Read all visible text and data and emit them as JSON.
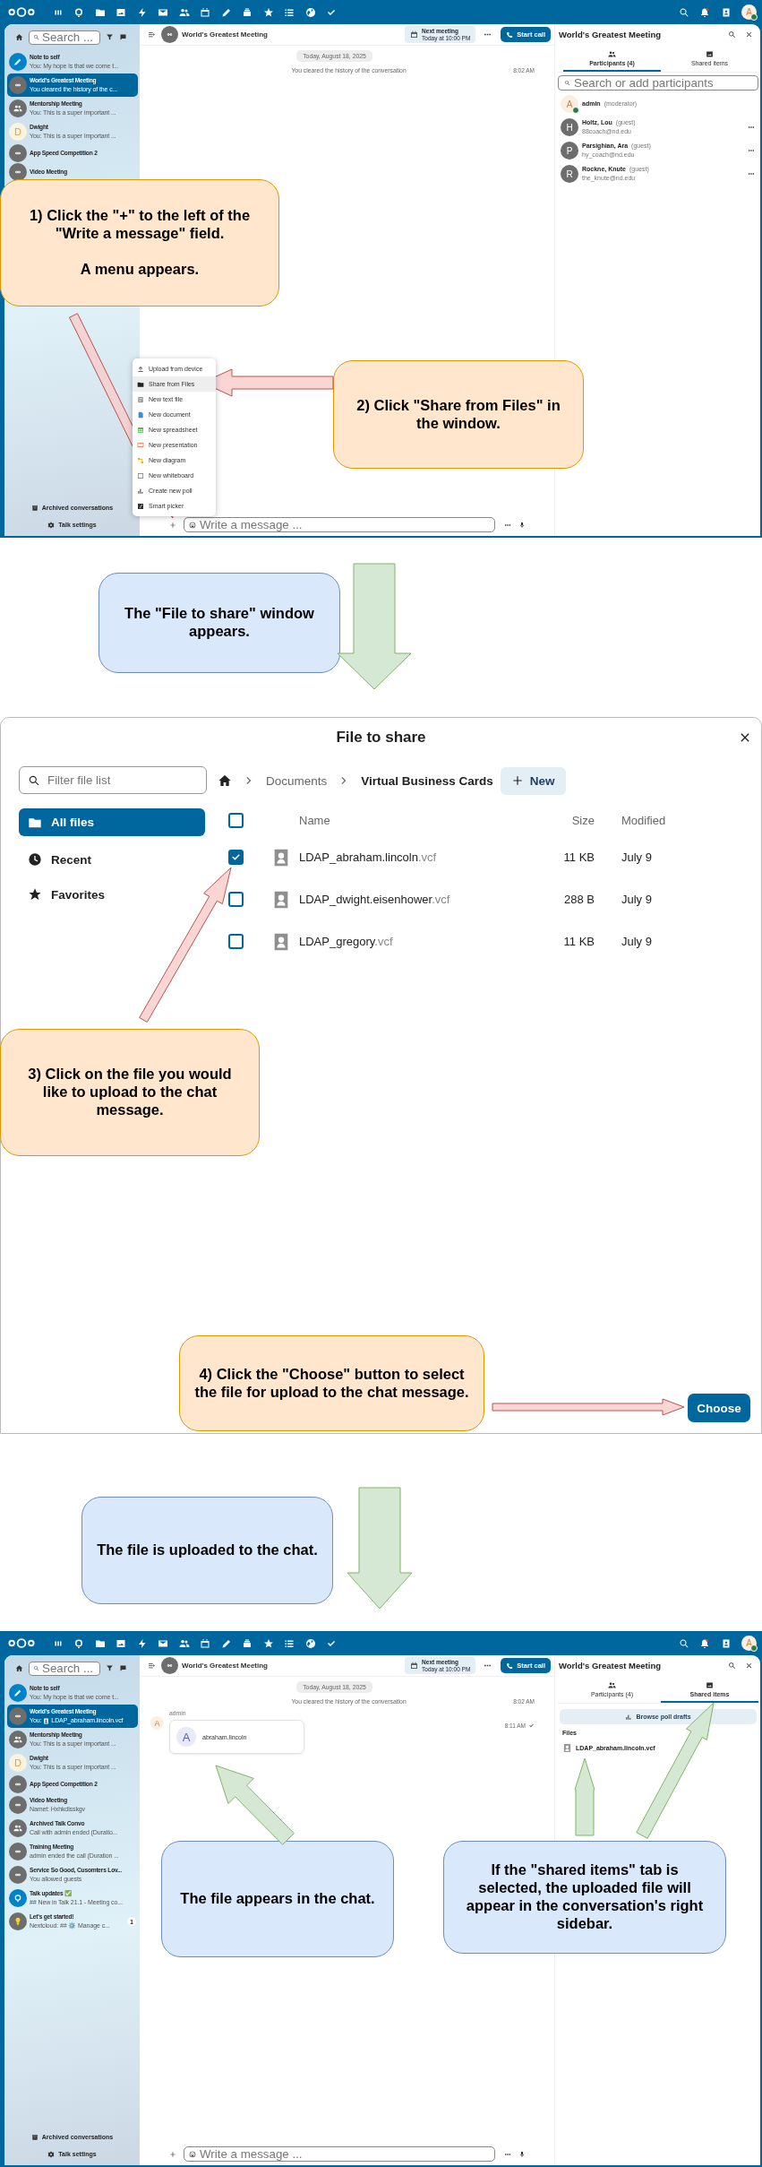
{
  "sections": [
    {
      "kind": "talk",
      "app_bar": {
        "avatar": "A",
        "online": true
      },
      "sidebar": {
        "search_placeholder": "Search ...",
        "conversations": [
          {
            "kind": "note",
            "name": "Note to self",
            "preview": "You: My hope is that we come t...",
            "selected": false
          },
          {
            "kind": "public",
            "name": "World's Greatest Meeting",
            "preview": "You cleared the history of the c...",
            "selected": true
          },
          {
            "kind": "group",
            "name": "Mentorship Meeting",
            "preview": "You: This is a super important ...",
            "selected": false
          },
          {
            "kind": "user",
            "initial": "D",
            "name": "Dwight",
            "preview": "You: This is a super important ...",
            "selected": false
          },
          {
            "kind": "public",
            "name": "App Speed Competition 2",
            "selected": false
          },
          {
            "kind": "public",
            "name": "Video Meeting",
            "selected": false
          }
        ],
        "footer": [
          "Archived conversations",
          "Talk settings"
        ]
      },
      "chat": {
        "title": "World's Greatest Meeting",
        "next_meeting": {
          "label": "Next meeting",
          "time": "Today at 10:00 PM"
        },
        "call_button": "Start call",
        "date": "Today, August 18, 2025",
        "events": [
          {
            "kind": "system",
            "text": "You cleared the history of the conversation",
            "time": "8:02 AM"
          }
        ],
        "composer_placeholder": "Write a message ..."
      },
      "menu": {
        "items": [
          {
            "label": "Upload from device",
            "selected": false
          },
          {
            "label": "Share from Files",
            "selected": true
          },
          {
            "label": "New text file",
            "selected": false
          },
          {
            "label": "New document",
            "selected": false
          },
          {
            "label": "New spreadsheet",
            "selected": false
          },
          {
            "label": "New presentation",
            "selected": false
          },
          {
            "label": "New diagram",
            "selected": false
          },
          {
            "label": "New whiteboard",
            "selected": false
          },
          {
            "label": "Create new poll",
            "selected": false
          },
          {
            "label": "Smart picker",
            "selected": false
          }
        ]
      },
      "details": {
        "title": "World's Greatest Meeting",
        "tabs": [
          {
            "label": "Participants (4)",
            "selected": true
          },
          {
            "label": "Shared items",
            "selected": false
          }
        ],
        "search_placeholder": "Search or add participants",
        "participants": [
          {
            "kind": "moderator",
            "initial": "A",
            "name": "admin",
            "role": "(moderator)",
            "online": true
          },
          {
            "kind": "guest",
            "initial": "H",
            "name": "Holtz, Lou",
            "role": "(guest)",
            "email": "88coach@nd.edu",
            "online": false
          },
          {
            "kind": "guest",
            "initial": "P",
            "name": "Parsighian, Ara",
            "role": "(guest)",
            "email": "hy_coach@nd.edu",
            "online": false
          },
          {
            "kind": "guest",
            "initial": "R",
            "name": "Rockne, Knute",
            "role": "(guest)",
            "email": "the_knute@nd.edu",
            "online": false
          }
        ]
      },
      "callouts": [
        {
          "kind": "step",
          "paragraphs": [
            "1) Click the \"+\" to the left of the \"Write a message\" field.",
            "A menu appears."
          ]
        },
        {
          "kind": "step",
          "paragraphs": [
            "2) Click \"Share from Files\" in the window."
          ]
        }
      ]
    },
    {
      "kind": "transition",
      "callout": {
        "kind": "note",
        "paragraphs": [
          "The \"File to share\" window appears."
        ]
      }
    },
    {
      "kind": "picker",
      "title": "File to share",
      "filter_placeholder": "Filter file list",
      "places": [
        {
          "label": "All files",
          "selected": true
        },
        {
          "label": "Recent",
          "selected": false
        },
        {
          "label": "Favorites",
          "selected": false
        }
      ],
      "breadcrumb": [
        "Documents",
        "Virtual Business Cards"
      ],
      "new_button": "New",
      "columns": [
        "Name",
        "Size",
        "Modified"
      ],
      "all_checked": false,
      "files": [
        {
          "name": "LDAP_abraham.lincoln",
          "extension": ".vcf",
          "size": "11 KB",
          "modified": "July 9",
          "checked": true
        },
        {
          "name": "LDAP_dwight.eisenhower",
          "extension": ".vcf",
          "size": "288 B",
          "modified": "July 9",
          "checked": false
        },
        {
          "name": "LDAP_gregory",
          "extension": ".vcf",
          "size": "11 KB",
          "modified": "July 9",
          "checked": false
        }
      ],
      "choose_button": "Choose",
      "callouts": [
        {
          "kind": "step",
          "paragraphs": [
            "3) Click on the file you would like to upload to the chat message."
          ]
        },
        {
          "kind": "step",
          "paragraphs": [
            "4) Click the \"Choose\" button to select the file for upload to the chat message."
          ]
        }
      ]
    },
    {
      "kind": "transition",
      "callout": {
        "kind": "note",
        "paragraphs": [
          "The file is uploaded to the chat."
        ]
      }
    },
    {
      "kind": "talk",
      "app_bar": {
        "avatar": "A",
        "online": true
      },
      "sidebar": {
        "search_placeholder": "Search ...",
        "conversations": [
          {
            "kind": "note",
            "name": "Note to self",
            "preview": "You: My hope is that we come t...",
            "selected": false
          },
          {
            "kind": "public",
            "name": "World's Greatest Meeting",
            "preview": "You:",
            "attachment": "LDAP_abraham.lincoln.vcf",
            "selected": true
          },
          {
            "kind": "group",
            "name": "Mentorship Meeting",
            "preview": "You: This is a super important ...",
            "selected": false
          },
          {
            "kind": "user",
            "initial": "D",
            "name": "Dwight",
            "preview": "You: This is a super important ...",
            "selected": false
          },
          {
            "kind": "public",
            "name": "App Speed Competition 2",
            "selected": false
          },
          {
            "kind": "public",
            "name": "Video Meeting",
            "preview": "Namet: Hxhkdisskgv",
            "selected": false
          },
          {
            "kind": "group",
            "name": "Archived Talk Convo",
            "preview": "Call with admin ended (Duratio...",
            "selected": false
          },
          {
            "kind": "public",
            "name": "Training Meeting",
            "preview": "admin ended the call (Duration ...",
            "selected": false
          },
          {
            "kind": "public",
            "name": "Service So Good, Cusomters Lov...",
            "preview": "You allowed guests",
            "selected": false
          },
          {
            "kind": "bot",
            "name": "Talk updates ✅",
            "preview": "## New in Talk 21.1 - Meeting co...",
            "selected": false
          },
          {
            "kind": "tips",
            "name": "Let's get started!",
            "preview": "Nextcloud: ## ⚙️ Manage c...",
            "unread": "1",
            "selected": false
          }
        ],
        "footer": [
          "Archived conversations",
          "Talk settings"
        ]
      },
      "chat": {
        "title": "World's Greatest Meeting",
        "next_meeting": {
          "label": "Next meeting",
          "time": "Today at 10:00 PM"
        },
        "call_button": "Start call",
        "date": "Today, August 18, 2025",
        "events": [
          {
            "kind": "system",
            "text": "You cleared the history of the conversation",
            "time": "8:02 AM"
          },
          {
            "kind": "file",
            "author": "admin",
            "initial": "A",
            "file_initial": "A",
            "file": "abraham.lincoln",
            "time": "8:11 AM"
          }
        ],
        "composer_placeholder": "Write a message ..."
      },
      "details": {
        "title": "World's Greatest Meeting",
        "tabs": [
          {
            "label": "Participants (4)",
            "selected": false
          },
          {
            "label": "Shared items",
            "selected": true
          }
        ],
        "shared": {
          "poll_button": "Browse poll drafts",
          "heading": "Files",
          "files": [
            "LDAP_abraham.lincoln.vcf"
          ]
        }
      },
      "callouts": [
        {
          "kind": "note",
          "paragraphs": [
            "The file appears in the chat."
          ]
        },
        {
          "kind": "note",
          "paragraphs": [
            "If the \"shared items\" tab is selected, the uploaded file will appear in the conversation's right sidebar."
          ]
        }
      ]
    }
  ]
}
